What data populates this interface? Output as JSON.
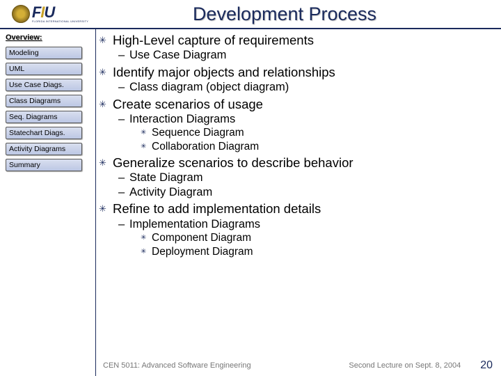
{
  "header": {
    "logo_letters": {
      "f": "F",
      "i": "I",
      "u": "U"
    },
    "logo_sub": "FLORIDA INTERNATIONAL UNIVERSITY",
    "title": "Development Process"
  },
  "sidebar": {
    "heading": "Overview:",
    "items": [
      {
        "label": "Modeling"
      },
      {
        "label": "UML"
      },
      {
        "label": "Use Case Diags."
      },
      {
        "label": "Class Diagrams"
      },
      {
        "label": "Seq. Diagrams"
      },
      {
        "label": "Statechart Diags."
      },
      {
        "label": "Activity Diagrams"
      },
      {
        "label": "Summary"
      }
    ]
  },
  "content": {
    "b0": {
      "text": "High-Level capture of requirements",
      "s0": "Use Case Diagram"
    },
    "b1": {
      "text": "Identify major objects and relationships",
      "s0": "Class diagram (object diagram)"
    },
    "b2": {
      "text": "Create scenarios of usage",
      "s0": "Interaction Diagrams",
      "t0": "Sequence Diagram",
      "t1": "Collaboration Diagram"
    },
    "b3": {
      "text": "Generalize scenarios to describe behavior",
      "s0": "State Diagram",
      "s1": "Activity Diagram"
    },
    "b4": {
      "text": "Refine to add implementation details",
      "s0": "Implementation Diagrams",
      "t0": "Component Diagram",
      "t1": "Deployment Diagram"
    }
  },
  "footer": {
    "left": "CEN 5011: Advanced Software Engineering",
    "center": "Second Lecture on Sept. 8, 2004",
    "page": "20"
  }
}
